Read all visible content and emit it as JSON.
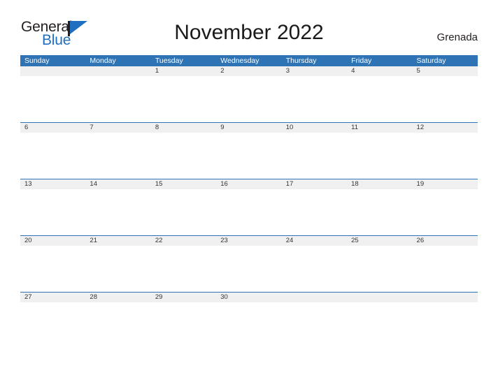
{
  "brand": {
    "name_top": "General",
    "name_bottom": "Blue",
    "accent_color": "#1f6fc0",
    "flag_icon": "flag-triangle-icon"
  },
  "header": {
    "title": "November 2022",
    "country": "Grenada"
  },
  "theme": {
    "header_blue": "#2e74b5",
    "band_gray": "#f0f0f0",
    "page_background": "#ffffff",
    "text_color": "#333333"
  },
  "calendar": {
    "month": "November",
    "year": "2022",
    "weekday_headers": [
      "Sunday",
      "Monday",
      "Tuesday",
      "Wednesday",
      "Thursday",
      "Friday",
      "Saturday"
    ],
    "weeks": [
      [
        "",
        "",
        "1",
        "2",
        "3",
        "4",
        "5"
      ],
      [
        "6",
        "7",
        "8",
        "9",
        "10",
        "11",
        "12"
      ],
      [
        "13",
        "14",
        "15",
        "16",
        "17",
        "18",
        "19"
      ],
      [
        "20",
        "21",
        "22",
        "23",
        "24",
        "25",
        "26"
      ],
      [
        "27",
        "28",
        "29",
        "30",
        "",
        "",
        ""
      ]
    ]
  }
}
